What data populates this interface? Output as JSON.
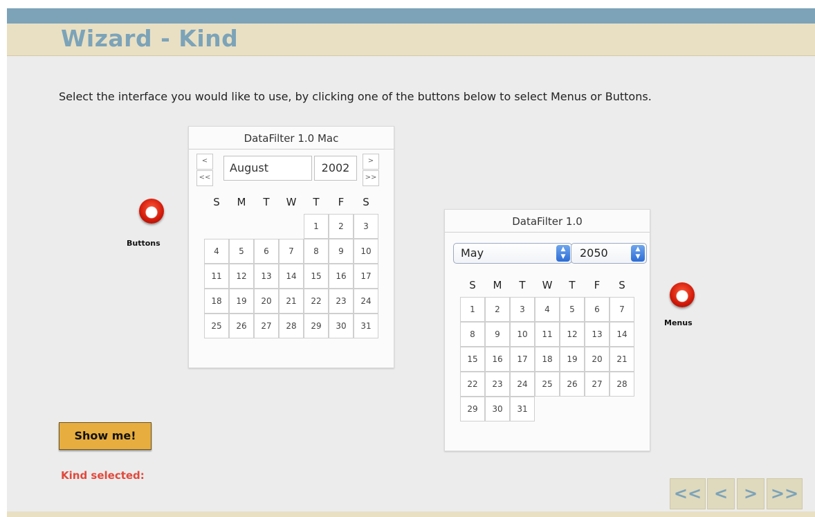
{
  "header": {
    "title": "Wizard - Kind"
  },
  "instructions": "Select the interface you would like to use, by clicking one of the buttons below to select Menus or Buttons.",
  "options": {
    "buttons_label": "Buttons",
    "menus_label": "Menus"
  },
  "mac_calendar": {
    "title": "DataFilter 1.0 Mac",
    "prev_label": "<",
    "prev_prev_label": "<<",
    "next_label": ">",
    "next_next_label": ">>",
    "month": "August",
    "year": "2002",
    "weekdays": [
      "S",
      "M",
      "T",
      "W",
      "T",
      "F",
      "S"
    ],
    "days": [
      "1",
      "2",
      "3",
      "4",
      "5",
      "6",
      "7",
      "8",
      "9",
      "10",
      "11",
      "12",
      "13",
      "14",
      "15",
      "16",
      "17",
      "18",
      "19",
      "20",
      "21",
      "22",
      "23",
      "24",
      "25",
      "26",
      "27",
      "28",
      "29",
      "30",
      "31"
    ]
  },
  "menu_calendar": {
    "title": "DataFilter 1.0",
    "month": "May",
    "year": "2050",
    "weekdays": [
      "S",
      "M",
      "T",
      "W",
      "T",
      "F",
      "S"
    ],
    "days": [
      "1",
      "2",
      "3",
      "4",
      "5",
      "6",
      "7",
      "8",
      "9",
      "10",
      "11",
      "12",
      "13",
      "14",
      "15",
      "16",
      "17",
      "18",
      "19",
      "20",
      "21",
      "22",
      "23",
      "24",
      "25",
      "26",
      "27",
      "28",
      "29",
      "30",
      "31"
    ]
  },
  "show_button": "Show me!",
  "kind_selected_label": "Kind selected:",
  "nav": {
    "first": "<<",
    "prev": "<",
    "next": ">",
    "last": ">>"
  },
  "colors": {
    "accent_blue": "#7ca3b8",
    "header_beige": "#e9e0c4",
    "button_orange": "#e7ad3e",
    "kind_selected_red": "#e1493c"
  }
}
